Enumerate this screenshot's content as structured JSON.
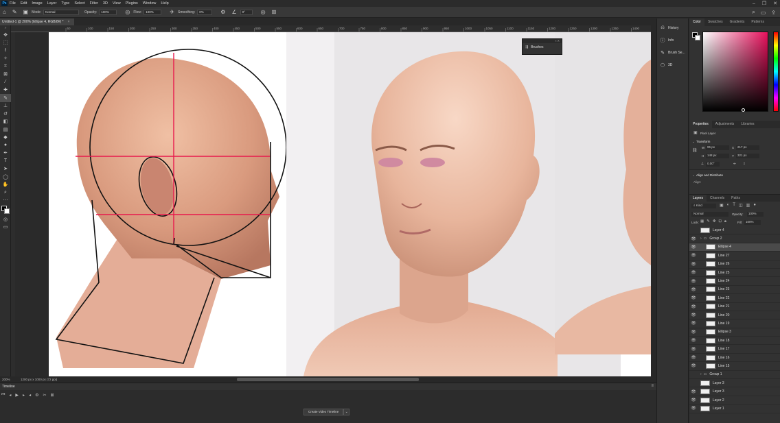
{
  "app": {
    "logo": "Ps"
  },
  "menu": [
    "File",
    "Edit",
    "Image",
    "Layer",
    "Type",
    "Select",
    "Filter",
    "3D",
    "View",
    "Plugins",
    "Window",
    "Help"
  ],
  "options": {
    "mode_label": "Mode:",
    "mode_value": "Normal",
    "opacity_label": "Opacity:",
    "opacity_value": "100%",
    "flow_label": "Flow:",
    "flow_value": "100%",
    "smoothing_label": "Smoothing:",
    "smoothing_value": "0%",
    "angle_value": "0°"
  },
  "document": {
    "tab_title": "Untitled-1 @ 200% (Ellipse 4, RGB/8#) *",
    "close": "×"
  },
  "ruler_ticks": [
    "50",
    "100",
    "150",
    "200",
    "250",
    "300",
    "350",
    "400",
    "450",
    "500",
    "550",
    "600",
    "650",
    "700",
    "750",
    "800",
    "850",
    "900",
    "950",
    "1000",
    "1050",
    "1100",
    "1150",
    "1200",
    "1250",
    "1300",
    "1350",
    "1400",
    "1450"
  ],
  "status": {
    "zoom": "200%",
    "doc_size": "1200 px x 1000 px (72 ppi)"
  },
  "timeline": {
    "title": "Timeline",
    "create_button": "Create Video Timeline"
  },
  "panel_strip": [
    {
      "icon": "history-icon",
      "label": "History"
    },
    {
      "icon": "info-icon",
      "label": "Info"
    },
    {
      "icon": "brush-settings-icon",
      "label": "Brush Se..."
    },
    {
      "icon": "3d-icon",
      "label": "3D"
    }
  ],
  "flyout": {
    "label": "Brushes"
  },
  "color_panel": {
    "tabs": [
      "Color",
      "Swatches",
      "Gradients",
      "Patterns"
    ],
    "hue_color": "#e8105c"
  },
  "properties": {
    "tabs": [
      "Properties",
      "Adjustments",
      "Libraries"
    ],
    "layer_type": "Pixel Layer",
    "transform_title": "Transform",
    "w_label": "W",
    "w_value": "95 px",
    "x_label": "X",
    "x_value": "217 px",
    "h_label": "H",
    "h_value": "148 px",
    "y_label": "Y",
    "y_value": "321 px",
    "angle_value": "0.00°",
    "align_title": "Align and Distribute",
    "align_sub": "Align:"
  },
  "layers_panel": {
    "tabs": [
      "Layers",
      "Channels",
      "Paths"
    ],
    "kind_label": "Kind",
    "blend_mode": "Normal",
    "opacity_label": "Opacity:",
    "opacity_value": "100%",
    "lock_label": "Lock:",
    "fill_label": "Fill:",
    "fill_value": "100%",
    "layers": [
      {
        "name": "Layer 4",
        "visible": false,
        "indent": 0,
        "selected": false
      },
      {
        "name": "Group 2",
        "visible": true,
        "indent": 0,
        "selected": false,
        "group": true
      },
      {
        "name": "Ellipse 4",
        "visible": true,
        "indent": 1,
        "selected": true
      },
      {
        "name": "Line 27",
        "visible": true,
        "indent": 1,
        "selected": false
      },
      {
        "name": "Line 26",
        "visible": true,
        "indent": 1,
        "selected": false
      },
      {
        "name": "Line 25",
        "visible": true,
        "indent": 1,
        "selected": false
      },
      {
        "name": "Line 24",
        "visible": true,
        "indent": 1,
        "selected": false
      },
      {
        "name": "Line 23",
        "visible": true,
        "indent": 1,
        "selected": false
      },
      {
        "name": "Line 22",
        "visible": true,
        "indent": 1,
        "selected": false
      },
      {
        "name": "Line 21",
        "visible": true,
        "indent": 1,
        "selected": false
      },
      {
        "name": "Line 20",
        "visible": true,
        "indent": 1,
        "selected": false
      },
      {
        "name": "Line 19",
        "visible": true,
        "indent": 1,
        "selected": false
      },
      {
        "name": "Ellipse 3",
        "visible": true,
        "indent": 1,
        "selected": false
      },
      {
        "name": "Line 18",
        "visible": true,
        "indent": 1,
        "selected": false
      },
      {
        "name": "Line 17",
        "visible": true,
        "indent": 1,
        "selected": false
      },
      {
        "name": "Line 16",
        "visible": true,
        "indent": 1,
        "selected": false
      },
      {
        "name": "Line 15",
        "visible": true,
        "indent": 1,
        "selected": false
      },
      {
        "name": "Group 1",
        "visible": false,
        "indent": 0,
        "selected": false,
        "group": true
      },
      {
        "name": "Layer 3",
        "visible": false,
        "indent": 0,
        "selected": false
      },
      {
        "name": "Layer 3",
        "visible": true,
        "indent": 0,
        "selected": false
      },
      {
        "name": "Layer 2",
        "visible": true,
        "indent": 0,
        "selected": false
      },
      {
        "name": "Layer 1",
        "visible": true,
        "indent": 0,
        "selected": false
      }
    ]
  }
}
